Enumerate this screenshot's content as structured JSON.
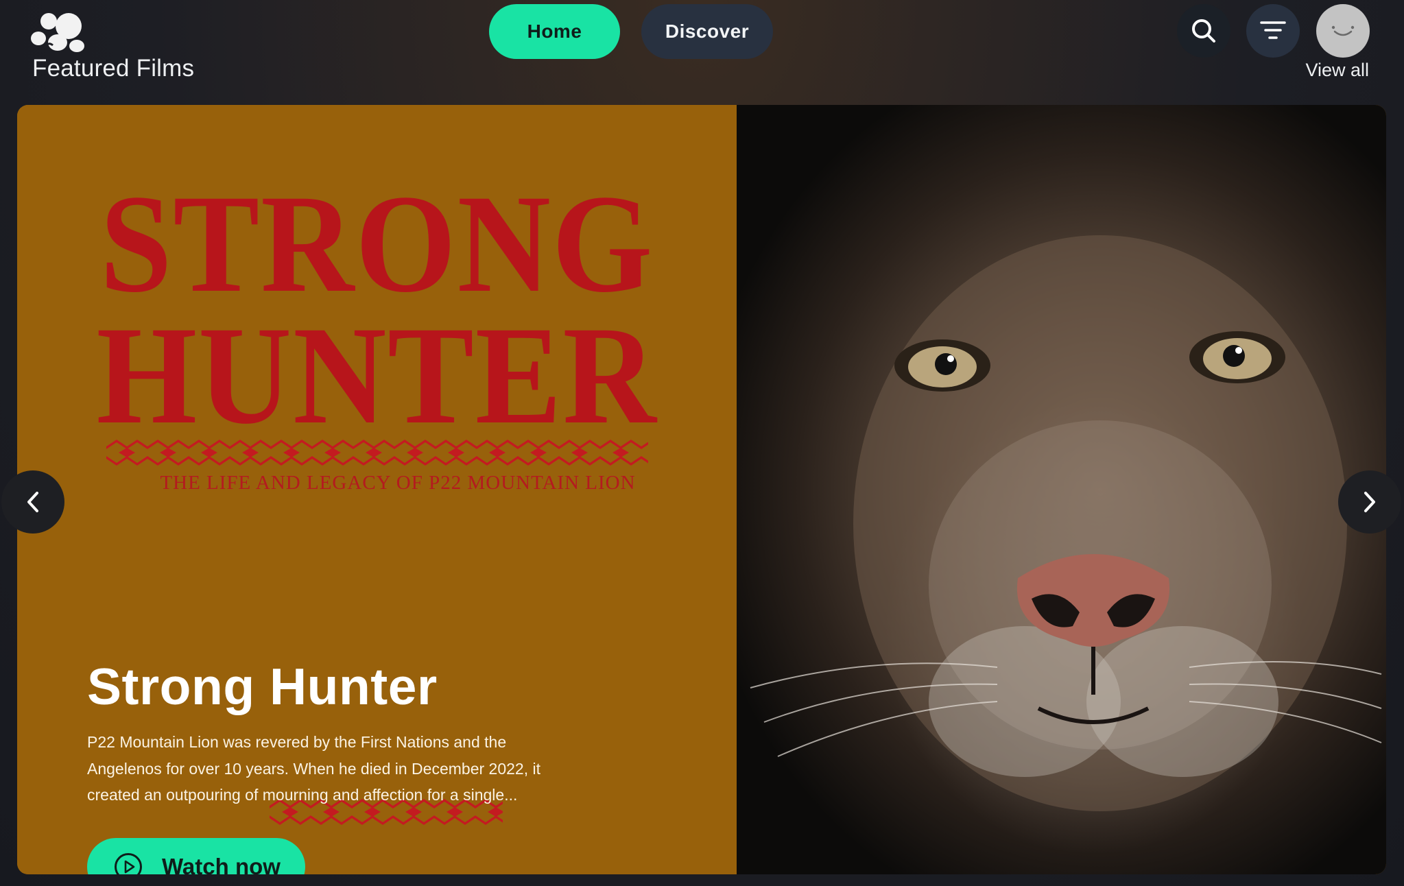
{
  "header": {
    "logo_icon": "paw-cluster-logo-icon",
    "section_title": "Featured Films",
    "view_all": "View all",
    "nav": [
      {
        "label": "Home",
        "active": true
      },
      {
        "label": "Discover",
        "active": false
      }
    ],
    "icons": [
      "search-icon",
      "filter-icon",
      "avatar-icon"
    ]
  },
  "featured": {
    "poster": {
      "title_line1": "STRONG",
      "title_line2": "HUNTER",
      "subtitle": "THE LIFE AND LEGACY OF P22 MOUNTAIN LION"
    },
    "title": "Strong Hunter",
    "description": "P22 Mountain Lion was revered by the First Nations and the Angelenos for over 10 years. When he died in December 2022, it created an outpouring of mourning and affection for a single...",
    "watch_label": "Watch now",
    "controls": [
      "chevron-left-icon",
      "chevron-right-icon"
    ]
  },
  "colors": {
    "accent": "#19e3a4",
    "poster_bg": "#98610b",
    "poster_text": "#b7151b",
    "header_bg": "#1d1e24"
  }
}
